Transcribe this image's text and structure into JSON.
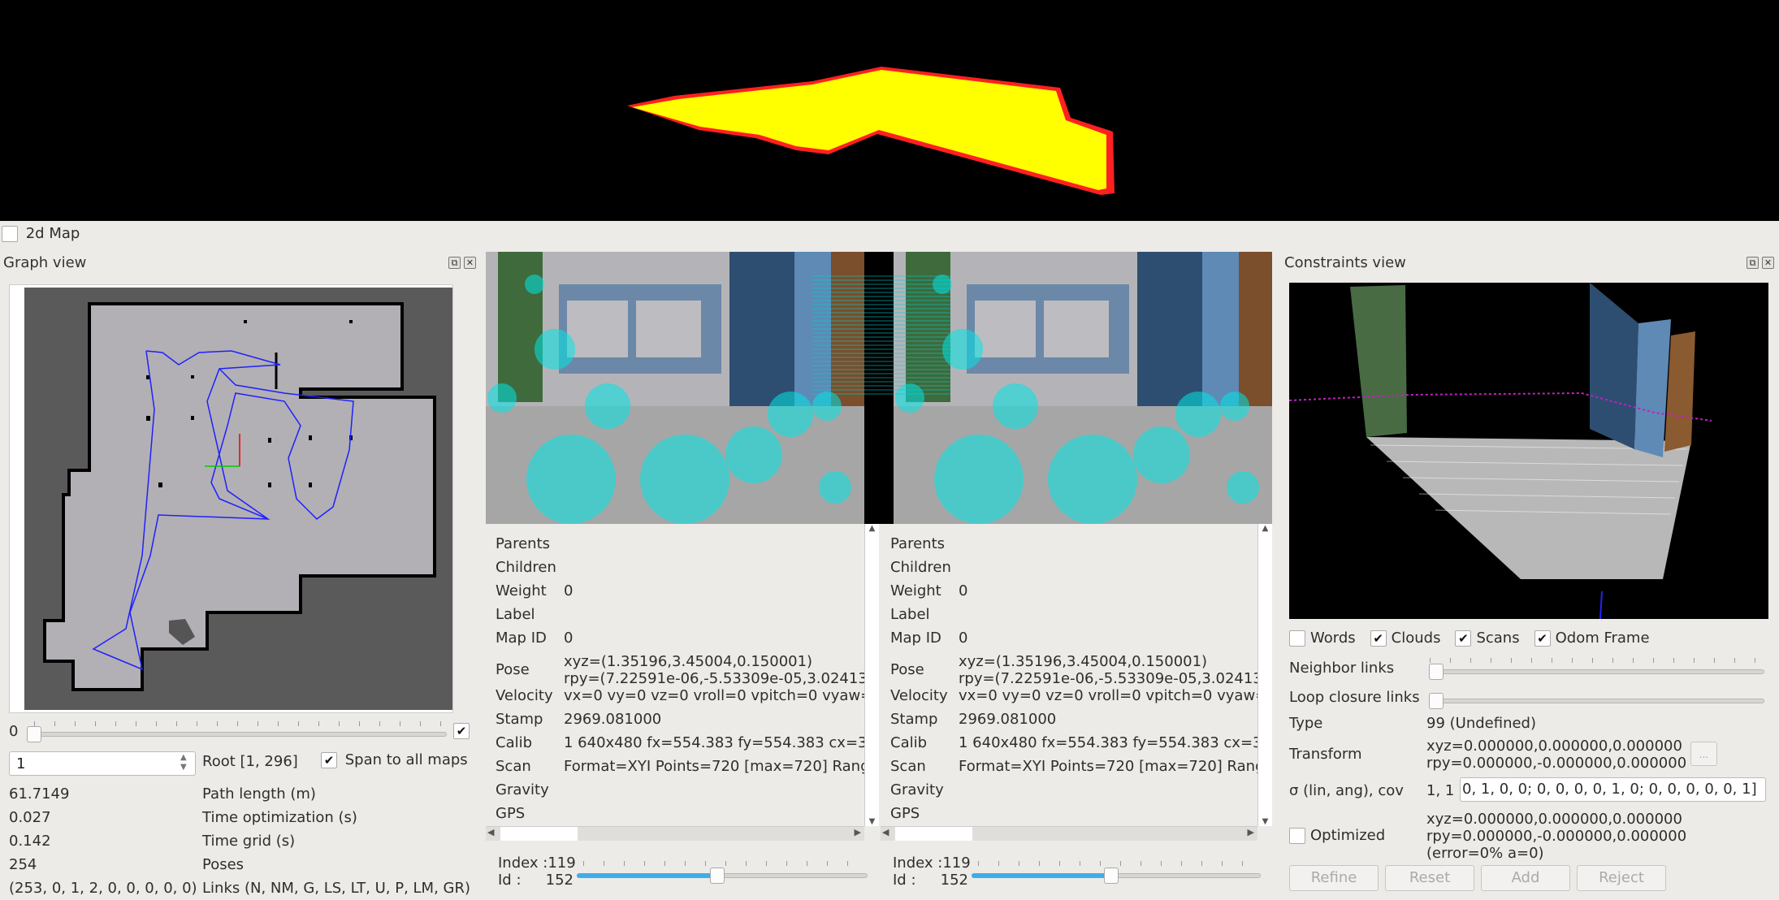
{
  "top_view": {
    "map_color": "#ffff00",
    "edge_color": "#ff2020"
  },
  "map2d": {
    "label": "2d Map",
    "checked": false
  },
  "graph_view": {
    "title": "Graph view",
    "slider_min_label": "0",
    "slider_checked": true,
    "root_value": "1",
    "root_label": "Root [1, 296]",
    "span_label": "Span to all maps",
    "span_checked": true,
    "stats": [
      {
        "value": "61.7149",
        "label": "Path length (m)"
      },
      {
        "value": "0.027",
        "label": "Time optimization (s)"
      },
      {
        "value": "0.142",
        "label": "Time grid (s)"
      },
      {
        "value": "254",
        "label": "Poses"
      },
      {
        "value": "(253, 0, 1, 2, 0, 0, 0, 0, 0)",
        "label": "Links (N, NM, G, LS, LT, U, P, LM, GR)"
      }
    ],
    "path_color": "#2020ff"
  },
  "node_panels": [
    {
      "fields": [
        {
          "k": "Parents",
          "v": ""
        },
        {
          "k": "Children",
          "v": ""
        },
        {
          "k": "Weight",
          "v": "0"
        },
        {
          "k": "Label",
          "v": ""
        },
        {
          "k": "Map ID",
          "v": "0"
        },
        {
          "k": "Pose",
          "v": "xyz=(1.35196,3.45004,0.150001)",
          "v2": "rpy=(7.22591e-06,-5.53309e-05,3.02413"
        },
        {
          "k": "Velocity",
          "v": "vx=0 vy=0 vz=0 vroll=0 vpitch=0 vyaw="
        },
        {
          "k": "Stamp",
          "v": "2969.081000"
        },
        {
          "k": "Calib",
          "v": "1 640x480 fx=554.383 fy=554.383 cx=3"
        },
        {
          "k": "Scan",
          "v": "Format=XYI Points=720 [max=720] Rang"
        },
        {
          "k": "Gravity",
          "v": ""
        },
        {
          "k": "GPS",
          "v": ""
        }
      ],
      "index_label": "Index :119",
      "id_label": "Id :",
      "id_value": "152",
      "slider_fraction": 0.47
    },
    {
      "fields": [
        {
          "k": "Parents",
          "v": ""
        },
        {
          "k": "Children",
          "v": ""
        },
        {
          "k": "Weight",
          "v": "0"
        },
        {
          "k": "Label",
          "v": ""
        },
        {
          "k": "Map ID",
          "v": "0"
        },
        {
          "k": "Pose",
          "v": "xyz=(1.35196,3.45004,0.150001)",
          "v2": "rpy=(7.22591e-06,-5.53309e-05,3.02413"
        },
        {
          "k": "Velocity",
          "v": "vx=0 vy=0 vz=0 vroll=0 vpitch=0 vyaw="
        },
        {
          "k": "Stamp",
          "v": "2969.081000"
        },
        {
          "k": "Calib",
          "v": "1 640x480 fx=554.383 fy=554.383 cx=3"
        },
        {
          "k": "Scan",
          "v": "Format=XYI Points=720 [max=720] Rang"
        },
        {
          "k": "Gravity",
          "v": ""
        },
        {
          "k": "GPS",
          "v": ""
        }
      ],
      "index_label": "Index :119",
      "id_label": "Id :",
      "id_value": "152",
      "slider_fraction": 0.47
    }
  ],
  "constraints_view": {
    "title": "Constraints view",
    "checkboxes": [
      {
        "label": "Words",
        "checked": false
      },
      {
        "label": "Clouds",
        "checked": true
      },
      {
        "label": "Scans",
        "checked": true
      },
      {
        "label": "Odom Frame",
        "checked": true
      }
    ],
    "neighbor_links_label": "Neighbor links",
    "loop_links_label": "Loop closure links",
    "type_label": "Type",
    "type_value": "99  (Undefined)",
    "transform_label": "Transform",
    "transform_xyz": "xyz=0.000000,0.000000,0.000000",
    "transform_rpy": "rpy=0.000000,-0.000000,0.000000",
    "more_button": "...",
    "sigma_label": "σ (lin, ang), cov",
    "sigma_value": "1, 1",
    "cov_value": "0, 1, 0, 0;  0, 0, 0, 0, 1, 0;  0, 0, 0, 0, 0, 1]",
    "optimized_label": "Optimized",
    "optimized_checked": false,
    "opt_xyz": "xyz=0.000000,0.000000,0.000000",
    "opt_rpy": "rpy=0.000000,-0.000000,0.000000",
    "opt_error": "(error=0% a=0)",
    "buttons": [
      "Refine",
      "Reset",
      "Add",
      "Reject"
    ]
  }
}
